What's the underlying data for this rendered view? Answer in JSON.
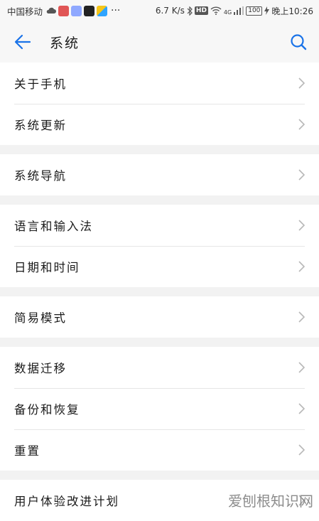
{
  "status_bar": {
    "carrier": "中国移动",
    "dots": "···",
    "speed": "6.7 K/s",
    "hd": "HD",
    "network": "4G",
    "battery": "100",
    "time": "晚上10:26"
  },
  "header": {
    "title": "系统",
    "back_icon": "arrow-left-icon",
    "search_icon": "search-icon",
    "accent_color": "#1a73e8"
  },
  "groups": [
    {
      "items": [
        {
          "label": "关于手机"
        },
        {
          "label": "系统更新"
        }
      ]
    },
    {
      "items": [
        {
          "label": "系统导航"
        }
      ]
    },
    {
      "items": [
        {
          "label": "语言和输入法"
        },
        {
          "label": "日期和时间"
        }
      ]
    },
    {
      "items": [
        {
          "label": "简易模式"
        }
      ]
    },
    {
      "items": [
        {
          "label": "数据迁移"
        },
        {
          "label": "备份和恢复"
        },
        {
          "label": "重置"
        }
      ]
    },
    {
      "items": [
        {
          "label": "用户体验改进计划"
        }
      ]
    }
  ],
  "watermark": "爱刨根知识网"
}
